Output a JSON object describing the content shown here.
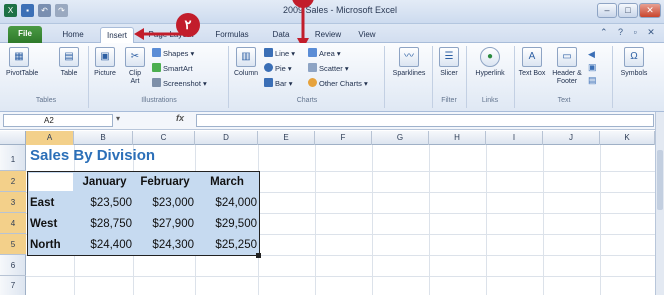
{
  "window": {
    "title": "2009 Sales - Microsoft Excel",
    "controls": [
      "–",
      "□",
      "✕"
    ]
  },
  "tabs": [
    "File",
    "Home",
    "Insert",
    "Page Layout",
    "Formulas",
    "Data",
    "Review",
    "View"
  ],
  "ribbon": {
    "groups": {
      "tables": "Tables",
      "illustrations": "Illustrations",
      "charts": "Charts",
      "filter": "Filter",
      "links": "Links",
      "text": "Text"
    },
    "buttons": {
      "pivottable": "PivotTable",
      "table": "Table",
      "picture": "Picture",
      "clip_art": "Clip Art",
      "shapes": "Shapes",
      "smartart": "SmartArt",
      "screenshot": "Screenshot",
      "column": "Column",
      "line": "Line",
      "pie": "Pie",
      "bar": "Bar",
      "area": "Area",
      "scatter": "Scatter",
      "other_charts": "Other Charts",
      "sparklines": "Sparklines",
      "slicer": "Slicer",
      "hyperlink": "Hyperlink",
      "text_box": "Text Box",
      "header_footer": "Header & Footer",
      "symbols": "Symbols"
    }
  },
  "formula_bar": {
    "name_box": "A2",
    "fx": "fx",
    "value": ""
  },
  "columns": [
    "A",
    "B",
    "C",
    "D",
    "E",
    "F",
    "G",
    "H",
    "I",
    "J",
    "K"
  ],
  "rows": [
    "1",
    "2",
    "3",
    "4",
    "5",
    "6",
    "7"
  ],
  "sheet": {
    "title": "Sales By Division",
    "headers": [
      "January",
      "February",
      "March"
    ],
    "data": [
      {
        "division": "East",
        "values": [
          "$23,500",
          "$23,000",
          "$24,000"
        ]
      },
      {
        "division": "West",
        "values": [
          "$28,750",
          "$27,900",
          "$29,500"
        ]
      },
      {
        "division": "North",
        "values": [
          "$24,400",
          "$24,300",
          "$25,250"
        ]
      }
    ]
  },
  "callouts": {
    "step2": "٢"
  },
  "colors": {
    "callout": "#c21d2b",
    "selection": "#c6daf0",
    "title_text": "#2b6fb8",
    "file_tab": "#2f7a2b"
  }
}
